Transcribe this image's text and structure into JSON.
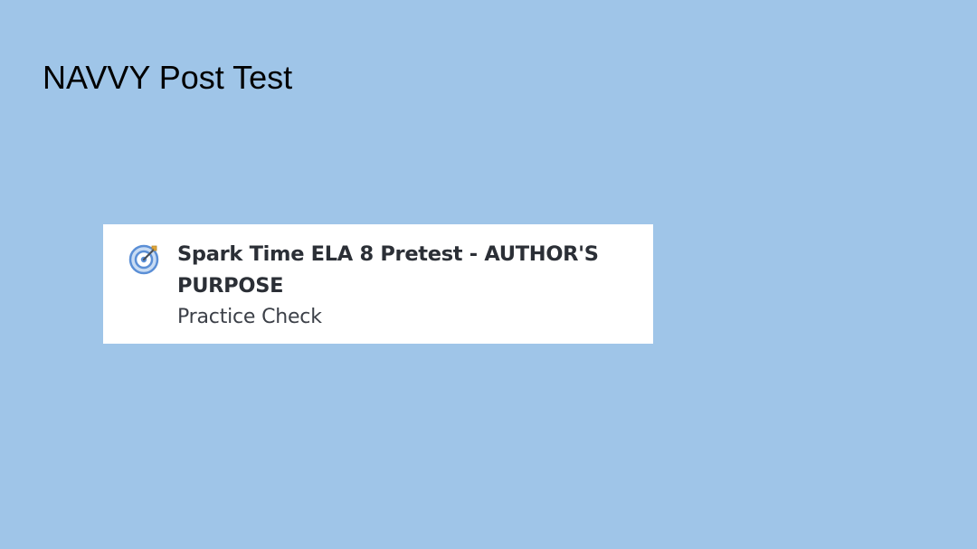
{
  "slide": {
    "title": "NAVVY Post Test"
  },
  "assignment_card": {
    "icon": "target-icon",
    "title": "Spark Time ELA 8 Pretest - AUTHOR'S PURPOSE",
    "subtitle": "Practice Check"
  },
  "colors": {
    "background": "#9fc5e8",
    "card": "#ffffff",
    "icon_accent": "#5b8fd6",
    "icon_light": "#c9dcf3",
    "title_text": "#2b2f36"
  }
}
